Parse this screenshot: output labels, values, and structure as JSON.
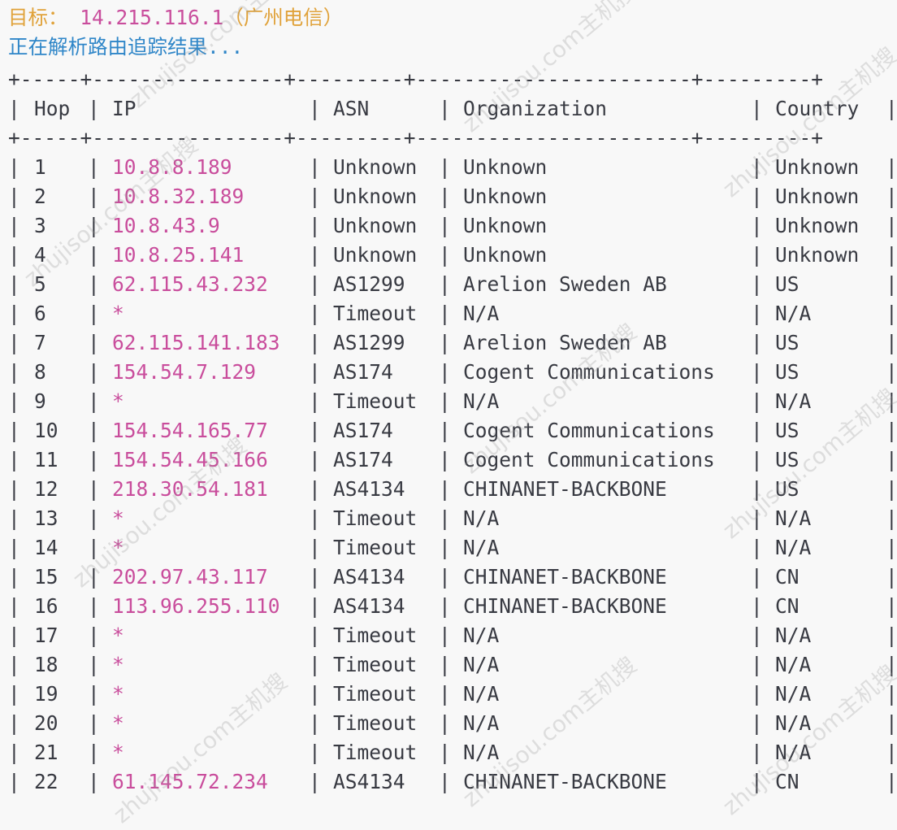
{
  "target_prefix": "目标：",
  "target_ip": "14.215.116.1",
  "target_isp": "（广州电信）",
  "status": "正在解析路由追踪结果...",
  "border": "+-----+----------------+---------+-----------------------+---------+",
  "headers": {
    "hop": "Hop",
    "ip": "IP",
    "asn": "ASN",
    "org": "Organization",
    "country": "Country"
  },
  "rows": [
    {
      "hop": "1",
      "ip": "10.8.8.189",
      "asn": "Unknown",
      "org": "Unknown",
      "country": "Unknown"
    },
    {
      "hop": "2",
      "ip": "10.8.32.189",
      "asn": "Unknown",
      "org": "Unknown",
      "country": "Unknown"
    },
    {
      "hop": "3",
      "ip": "10.8.43.9",
      "asn": "Unknown",
      "org": "Unknown",
      "country": "Unknown"
    },
    {
      "hop": "4",
      "ip": "10.8.25.141",
      "asn": "Unknown",
      "org": "Unknown",
      "country": "Unknown"
    },
    {
      "hop": "5",
      "ip": "62.115.43.232",
      "asn": "AS1299",
      "org": "Arelion Sweden AB",
      "country": "US"
    },
    {
      "hop": "6",
      "ip": "*",
      "asn": "Timeout",
      "org": "N/A",
      "country": "N/A"
    },
    {
      "hop": "7",
      "ip": "62.115.141.183",
      "asn": "AS1299",
      "org": "Arelion Sweden AB",
      "country": "US"
    },
    {
      "hop": "8",
      "ip": "154.54.7.129",
      "asn": "AS174",
      "org": "Cogent Communications",
      "country": "US"
    },
    {
      "hop": "9",
      "ip": "*",
      "asn": "Timeout",
      "org": "N/A",
      "country": "N/A"
    },
    {
      "hop": "10",
      "ip": "154.54.165.77",
      "asn": "AS174",
      "org": "Cogent Communications",
      "country": "US"
    },
    {
      "hop": "11",
      "ip": "154.54.45.166",
      "asn": "AS174",
      "org": "Cogent Communications",
      "country": "US"
    },
    {
      "hop": "12",
      "ip": "218.30.54.181",
      "asn": "AS4134",
      "org": "CHINANET-BACKBONE",
      "country": "US"
    },
    {
      "hop": "13",
      "ip": "*",
      "asn": "Timeout",
      "org": "N/A",
      "country": "N/A"
    },
    {
      "hop": "14",
      "ip": "*",
      "asn": "Timeout",
      "org": "N/A",
      "country": "N/A"
    },
    {
      "hop": "15",
      "ip": "202.97.43.117",
      "asn": "AS4134",
      "org": "CHINANET-BACKBONE",
      "country": "CN"
    },
    {
      "hop": "16",
      "ip": "113.96.255.110",
      "asn": "AS4134",
      "org": "CHINANET-BACKBONE",
      "country": "CN"
    },
    {
      "hop": "17",
      "ip": "*",
      "asn": "Timeout",
      "org": "N/A",
      "country": "N/A"
    },
    {
      "hop": "18",
      "ip": "*",
      "asn": "Timeout",
      "org": "N/A",
      "country": "N/A"
    },
    {
      "hop": "19",
      "ip": "*",
      "asn": "Timeout",
      "org": "N/A",
      "country": "N/A"
    },
    {
      "hop": "20",
      "ip": "*",
      "asn": "Timeout",
      "org": "N/A",
      "country": "N/A"
    },
    {
      "hop": "21",
      "ip": "*",
      "asn": "Timeout",
      "org": "N/A",
      "country": "N/A"
    },
    {
      "hop": "22",
      "ip": "61.145.72.234",
      "asn": "AS4134",
      "org": "CHINANET-BACKBONE",
      "country": "CN"
    }
  ],
  "watermark_text": "zhujisou.com主机搜",
  "colors": {
    "target": "#e0a23a",
    "ip": "#c94d9c",
    "status": "#2f86c8",
    "text": "#383a42",
    "background": "#f8f8f8"
  }
}
